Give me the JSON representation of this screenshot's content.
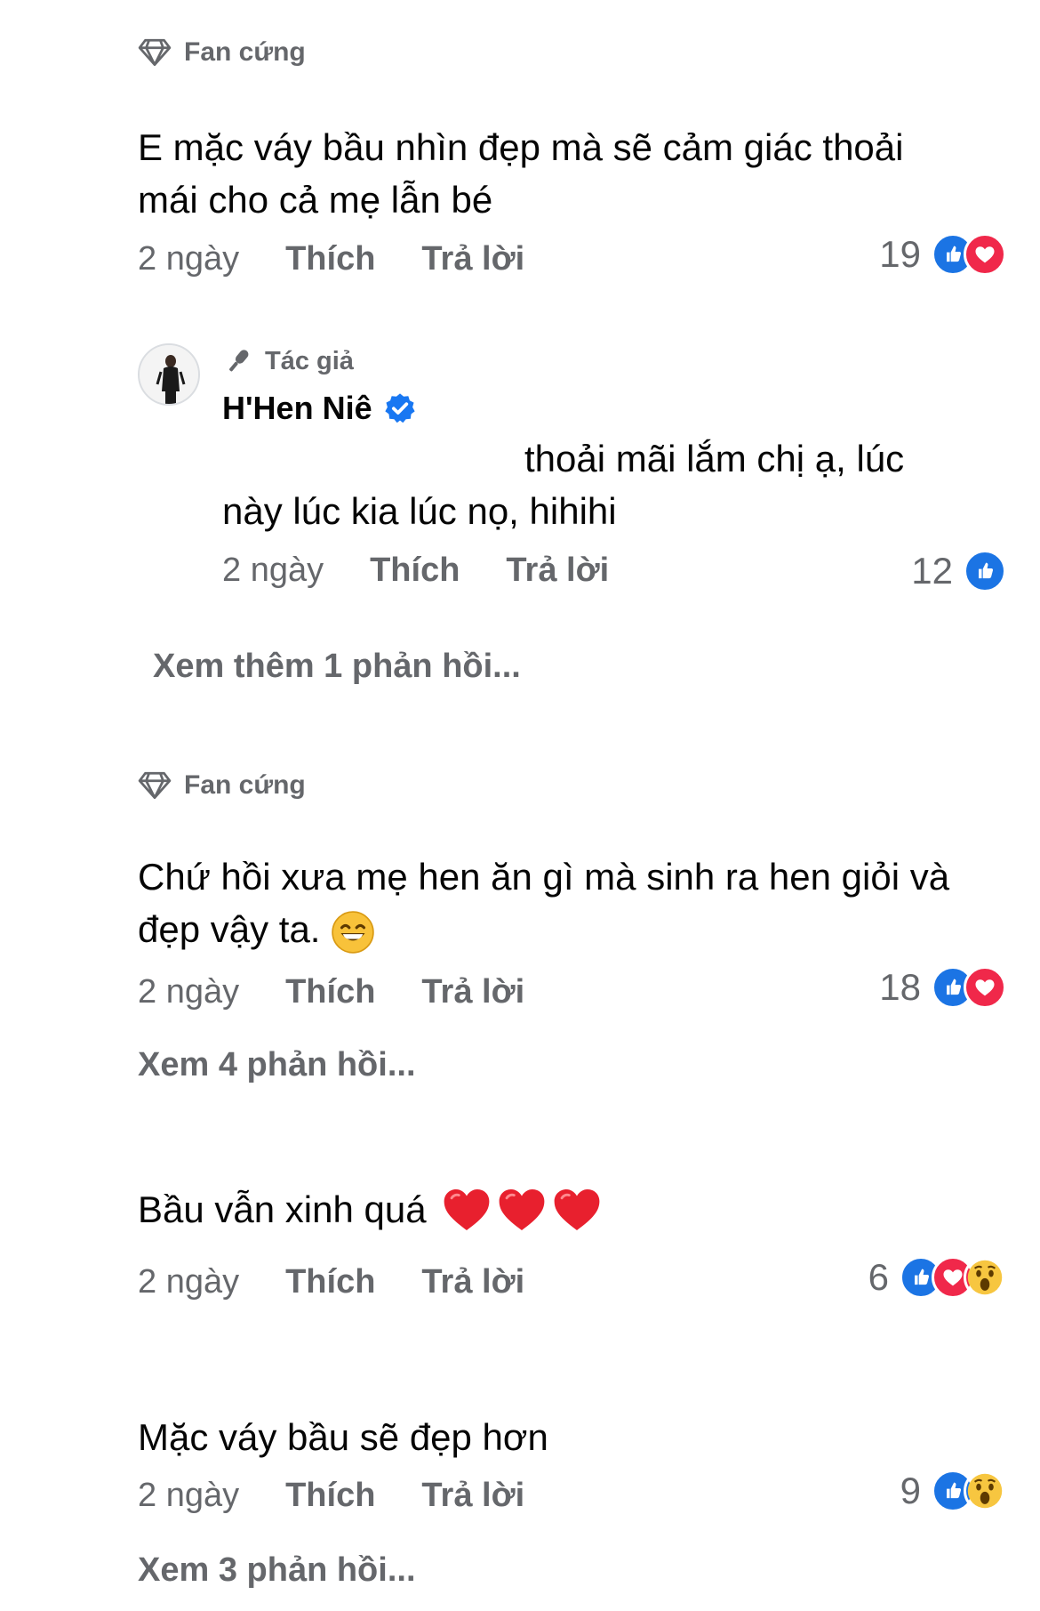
{
  "comments": [
    {
      "badge": "Fan cứng",
      "text": "E mặc váy bầu nhìn đẹp mà sẽ cảm giác thoải mái cho cả mẹ lẫn bé",
      "time": "2 ngày",
      "like_label": "Thích",
      "reply_label": "Trả lời",
      "reaction_count": "19",
      "reactions": [
        "like-icon",
        "love-icon"
      ]
    },
    {
      "author_badge": "Tác giả",
      "author_name": "H'Hen Niê",
      "verified": true,
      "text_line1": "thoải mãi lắm chị ạ, lúc",
      "text_line2": "này lúc kia lúc nọ, hihihi",
      "time": "2 ngày",
      "like_label": "Thích",
      "reply_label": "Trả lời",
      "reaction_count": "12",
      "reactions": [
        "like-icon"
      ]
    },
    {
      "more_replies": "Xem thêm 1 phản hồi..."
    },
    {
      "badge": "Fan cứng",
      "text": "Chứ hồi xưa mẹ hen ăn gì mà sinh ra hen giỏi và đẹp vậy ta.",
      "emoji": "grinning-face-emoji",
      "time": "2 ngày",
      "like_label": "Thích",
      "reply_label": "Trả lời",
      "reaction_count": "18",
      "reactions": [
        "like-icon",
        "love-icon"
      ],
      "more_replies": "Xem 4 phản hồi..."
    },
    {
      "text": "Bầu vẫn xinh quá",
      "emoji": "red-heart-emoji",
      "time": "2 ngày",
      "like_label": "Thích",
      "reply_label": "Trả lời",
      "reaction_count": "6",
      "reactions": [
        "like-icon",
        "love-icon",
        "wow-icon"
      ]
    },
    {
      "text": "Mặc váy bầu sẽ đẹp hơn",
      "time": "2 ngày",
      "like_label": "Thích",
      "reply_label": "Trả lời",
      "reaction_count": "9",
      "reactions": [
        "like-icon",
        "wow-icon"
      ],
      "more_replies": "Xem 3 phản hồi..."
    }
  ],
  "colors": {
    "like": "#1b74e4",
    "love": "#f0284a",
    "wow": "#f7c640",
    "verified": "#1877f2",
    "secondary_text": "#65676b"
  }
}
